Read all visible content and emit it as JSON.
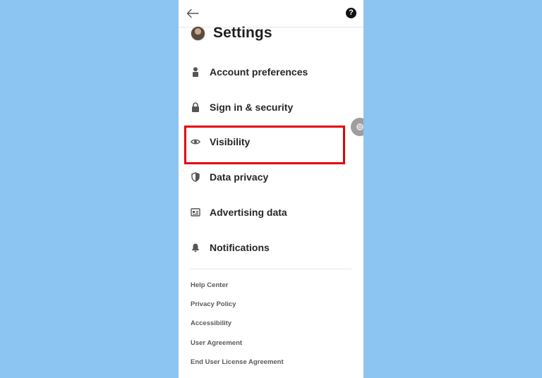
{
  "header": {
    "title": "Settings"
  },
  "topbar": {
    "back_icon": "arrow-left-icon",
    "help_glyph": "?"
  },
  "menu": [
    {
      "label": "Account preferences",
      "icon": "person-icon"
    },
    {
      "label": "Sign in & security",
      "icon": "lock-icon"
    },
    {
      "label": "Visibility",
      "icon": "eye-icon"
    },
    {
      "label": "Data privacy",
      "icon": "shield-icon"
    },
    {
      "label": "Advertising data",
      "icon": "ad-card-icon"
    },
    {
      "label": "Notifications",
      "icon": "bell-icon"
    }
  ],
  "footer": [
    "Help Center",
    "Privacy Policy",
    "Accessibility",
    "User Agreement",
    "End User License Agreement"
  ],
  "colors": {
    "background": "#8cc5f2",
    "highlight": "#e3000b",
    "text": "#262626"
  }
}
